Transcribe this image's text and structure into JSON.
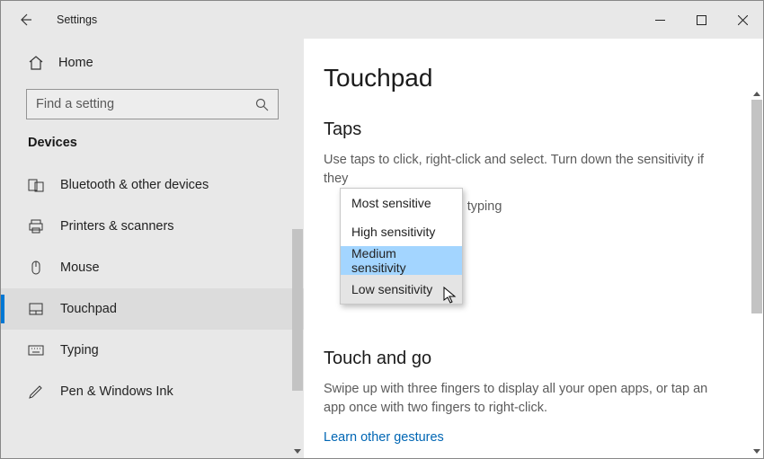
{
  "titlebar": {
    "title": "Settings"
  },
  "sidebar": {
    "home": "Home",
    "search_placeholder": "Find a setting",
    "category": "Devices",
    "items": [
      {
        "label": "Bluetooth & other devices",
        "icon": "bluetooth-devices-icon",
        "selected": false
      },
      {
        "label": "Printers & scanners",
        "icon": "printer-icon",
        "selected": false
      },
      {
        "label": "Mouse",
        "icon": "mouse-icon",
        "selected": false
      },
      {
        "label": "Touchpad",
        "icon": "touchpad-icon",
        "selected": true
      },
      {
        "label": "Typing",
        "icon": "keyboard-icon",
        "selected": false
      },
      {
        "label": "Pen & Windows Ink",
        "icon": "pen-icon",
        "selected": false
      }
    ]
  },
  "content": {
    "page_title": "Touchpad",
    "taps": {
      "title": "Taps",
      "desc_line1": "Use taps to click, right-click and select. Turn down the sensitivity if they",
      "desc_tail": "'re typing"
    },
    "touch_and_go": {
      "title": "Touch and go",
      "desc": "Swipe up with three fingers to display all your open apps, or tap an app once with two fingers to right-click.",
      "link": "Learn other gestures"
    }
  },
  "dropdown": {
    "items": [
      {
        "label": "Most sensitive",
        "state": "normal"
      },
      {
        "label": "High sensitivity",
        "state": "normal"
      },
      {
        "label": "Medium sensitivity",
        "state": "selected"
      },
      {
        "label": "Low sensitivity",
        "state": "hover"
      }
    ]
  }
}
